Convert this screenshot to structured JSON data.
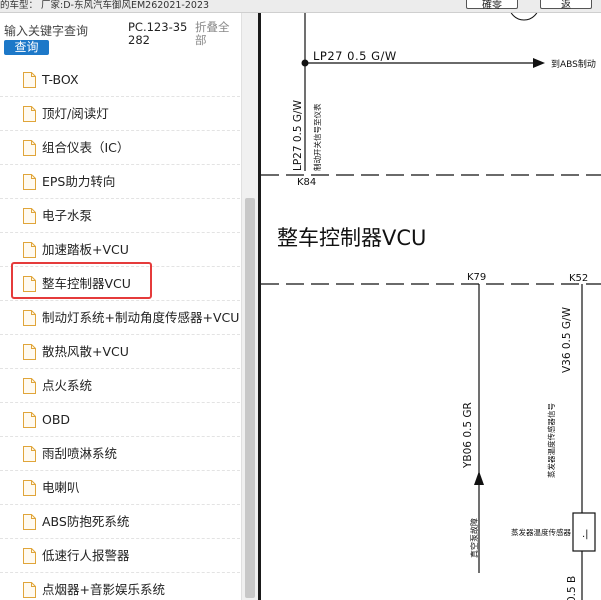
{
  "topbar": {
    "vehicle_text": "的车型： 厂家:D-东风汽车御风EM262021-2023",
    "btn1_label": "確零",
    "btn2_label": "返"
  },
  "search": {
    "placeholder": "输入关键字查询",
    "button_label": "查询",
    "code": "PC.123-35282",
    "collapse_label": "折叠全部"
  },
  "tree": {
    "items": [
      {
        "label": "T-BOX"
      },
      {
        "label": "顶灯/阅读灯"
      },
      {
        "label": "组合仪表（IC）"
      },
      {
        "label": "EPS助力转向"
      },
      {
        "label": "电子水泵"
      },
      {
        "label": "加速踏板+VCU"
      },
      {
        "label": "整车控制器VCU"
      },
      {
        "label": "制动灯系统+制动角度传感器+VCU"
      },
      {
        "label": "散热风散+VCU"
      },
      {
        "label": "点火系统"
      },
      {
        "label": "OBD"
      },
      {
        "label": "雨刮喷淋系统"
      },
      {
        "label": "电喇叭"
      },
      {
        "label": "ABS防抱死系统"
      },
      {
        "label": "低速行人报警器"
      },
      {
        "label": "点烟器+音影娱乐系统"
      }
    ],
    "selected_index": 6
  },
  "diagram": {
    "wire_top": "LP27  0.5  G/W",
    "arrow_dest": "到ABS制动",
    "wire_vertical": "LP27 0.5 G/W",
    "wire_vertical_desc": "制动开关信号至仪表",
    "connector_k84": "K84",
    "section_title": "整车控制器VCU",
    "connector_k79": "K79",
    "connector_k52": "K52",
    "wire_yb06": "YB06  0.5  GR",
    "wire_v36": "V36  0.5  G/W",
    "wire_v36_desc": "蒸发器温度传感器信号",
    "label_safety": "真空泵故障",
    "label_sensor": "蒸发器温度传感器",
    "wire_bottom": "0.5 B"
  }
}
